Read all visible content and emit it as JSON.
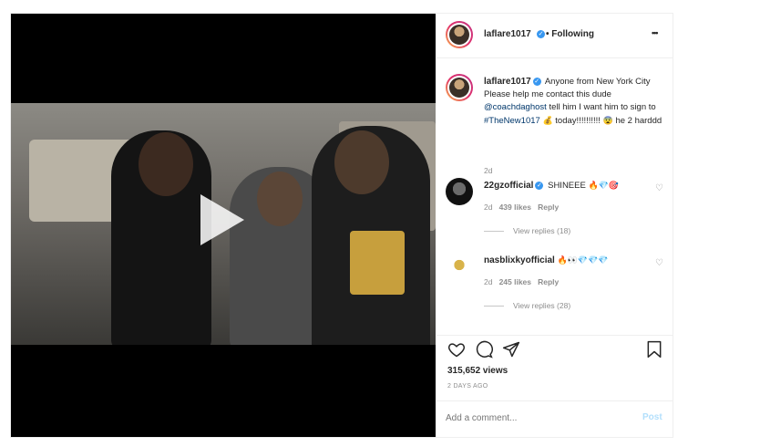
{
  "header": {
    "username": "laflare1017",
    "follow_status": "• Following",
    "more": "•••"
  },
  "caption": {
    "username": "laflare1017",
    "text_1": "Anyone from New York City Please help me contact this dude",
    "mention": "@coachdaghost",
    "text_2": "tell him I want him to sign to",
    "hashtag": "#TheNew1017",
    "text_3": "today!!!!!!!!!!",
    "text_4": "he 2 harddd",
    "time": "2d"
  },
  "comments": [
    {
      "username": "22gzofficial",
      "text": "SHINEEE",
      "time": "2d",
      "likes": "439 likes",
      "reply": "Reply",
      "view_replies": "View replies (18)"
    },
    {
      "username": "nasblixkyofficial",
      "text": "",
      "time": "2d",
      "likes": "245 likes",
      "reply": "Reply",
      "view_replies": "View replies (28)"
    }
  ],
  "stats": {
    "views": "315,652 views",
    "date": "2 DAYS AGO"
  },
  "composer": {
    "placeholder": "Add a comment...",
    "post_label": "Post"
  },
  "colors": {
    "link": "#00376b",
    "verified": "#3897f0",
    "muted": "#8e8e8e",
    "post_button": "#b2dffc"
  }
}
